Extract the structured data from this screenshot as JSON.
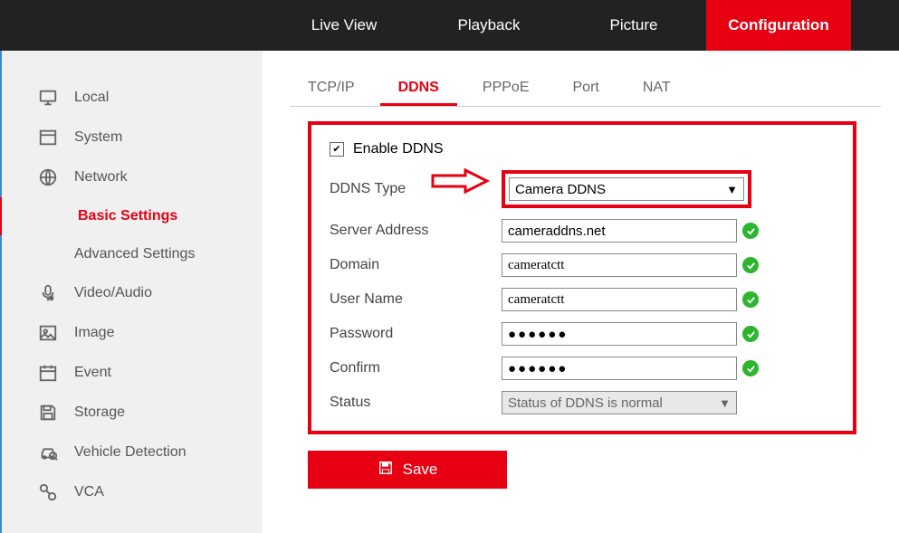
{
  "topbar": {
    "items": [
      {
        "label": "Live View"
      },
      {
        "label": "Playback"
      },
      {
        "label": "Picture"
      },
      {
        "label": "Configuration"
      }
    ]
  },
  "sidebar": {
    "local": "Local",
    "system": "System",
    "network": "Network",
    "basic_settings": "Basic Settings",
    "advanced_settings": "Advanced Settings",
    "video_audio": "Video/Audio",
    "image": "Image",
    "event": "Event",
    "storage": "Storage",
    "vehicle_detection": "Vehicle Detection",
    "vca": "VCA"
  },
  "tabs": {
    "tcpip": "TCP/IP",
    "ddns": "DDNS",
    "pppoe": "PPPoE",
    "port": "Port",
    "nat": "NAT"
  },
  "form": {
    "enable_ddns": "Enable DDNS",
    "ddns_type_label": "DDNS Type",
    "ddns_type_value": "Camera DDNS",
    "server_address_label": "Server Address",
    "server_address_value": "cameraddns.net",
    "domain_label": "Domain",
    "domain_value": "cameratctt",
    "username_label": "User Name",
    "username_value": "cameratctt",
    "password_label": "Password",
    "password_value": "●●●●●●",
    "confirm_label": "Confirm",
    "confirm_value": "●●●●●●",
    "status_label": "Status",
    "status_value": "Status of DDNS is normal"
  },
  "buttons": {
    "save": "Save"
  }
}
